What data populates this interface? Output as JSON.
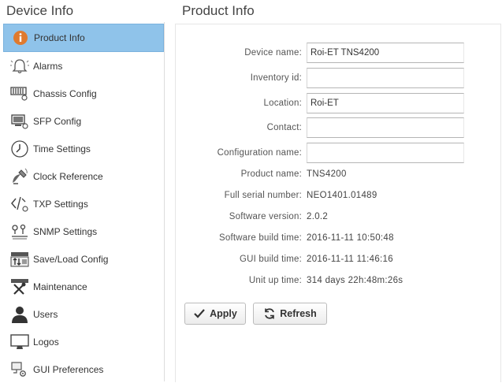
{
  "left_title": "Device Info",
  "right_title": "Product Info",
  "sidebar": {
    "items": [
      {
        "label": "Product Info",
        "icon": "info-icon"
      },
      {
        "label": "Alarms",
        "icon": "bell-icon"
      },
      {
        "label": "Chassis Config",
        "icon": "chassis-icon"
      },
      {
        "label": "SFP Config",
        "icon": "sfp-icon"
      },
      {
        "label": "Time Settings",
        "icon": "clock-icon"
      },
      {
        "label": "Clock Reference",
        "icon": "satellite-icon"
      },
      {
        "label": "TXP Settings",
        "icon": "code-icon"
      },
      {
        "label": "SNMP Settings",
        "icon": "network-icon"
      },
      {
        "label": "Save/Load Config",
        "icon": "save-load-icon"
      },
      {
        "label": "Maintenance",
        "icon": "tools-icon"
      },
      {
        "label": "Users",
        "icon": "user-icon"
      },
      {
        "label": "Logos",
        "icon": "monitor-icon"
      },
      {
        "label": "GUI Preferences",
        "icon": "preferences-icon"
      }
    ]
  },
  "form": {
    "device_name": {
      "label": "Device name:",
      "value": "Roi-ET TNS4200"
    },
    "inventory_id": {
      "label": "Inventory id:",
      "value": ""
    },
    "location": {
      "label": "Location:",
      "value": "Roi-ET"
    },
    "contact": {
      "label": "Contact:",
      "value": ""
    },
    "configuration_name": {
      "label": "Configuration name:",
      "value": ""
    }
  },
  "info": {
    "product_name": {
      "label": "Product name:",
      "value": "TNS4200"
    },
    "serial_number": {
      "label": "Full serial number:",
      "value": "NEO1401.01489"
    },
    "software_version": {
      "label": "Software version:",
      "value": "2.0.2"
    },
    "software_build_time": {
      "label": "Software build time:",
      "value": "2016-11-11 10:50:48"
    },
    "gui_build_time": {
      "label": "GUI build time:",
      "value": "2016-11-11 11:46:16"
    },
    "unit_up_time": {
      "label": "Unit up time:",
      "value": "314 days 22h:48m:26s"
    }
  },
  "buttons": {
    "apply": "Apply",
    "refresh": "Refresh"
  },
  "colors": {
    "active_item": "#8fc3ea",
    "info_icon": "#e07a2e"
  }
}
